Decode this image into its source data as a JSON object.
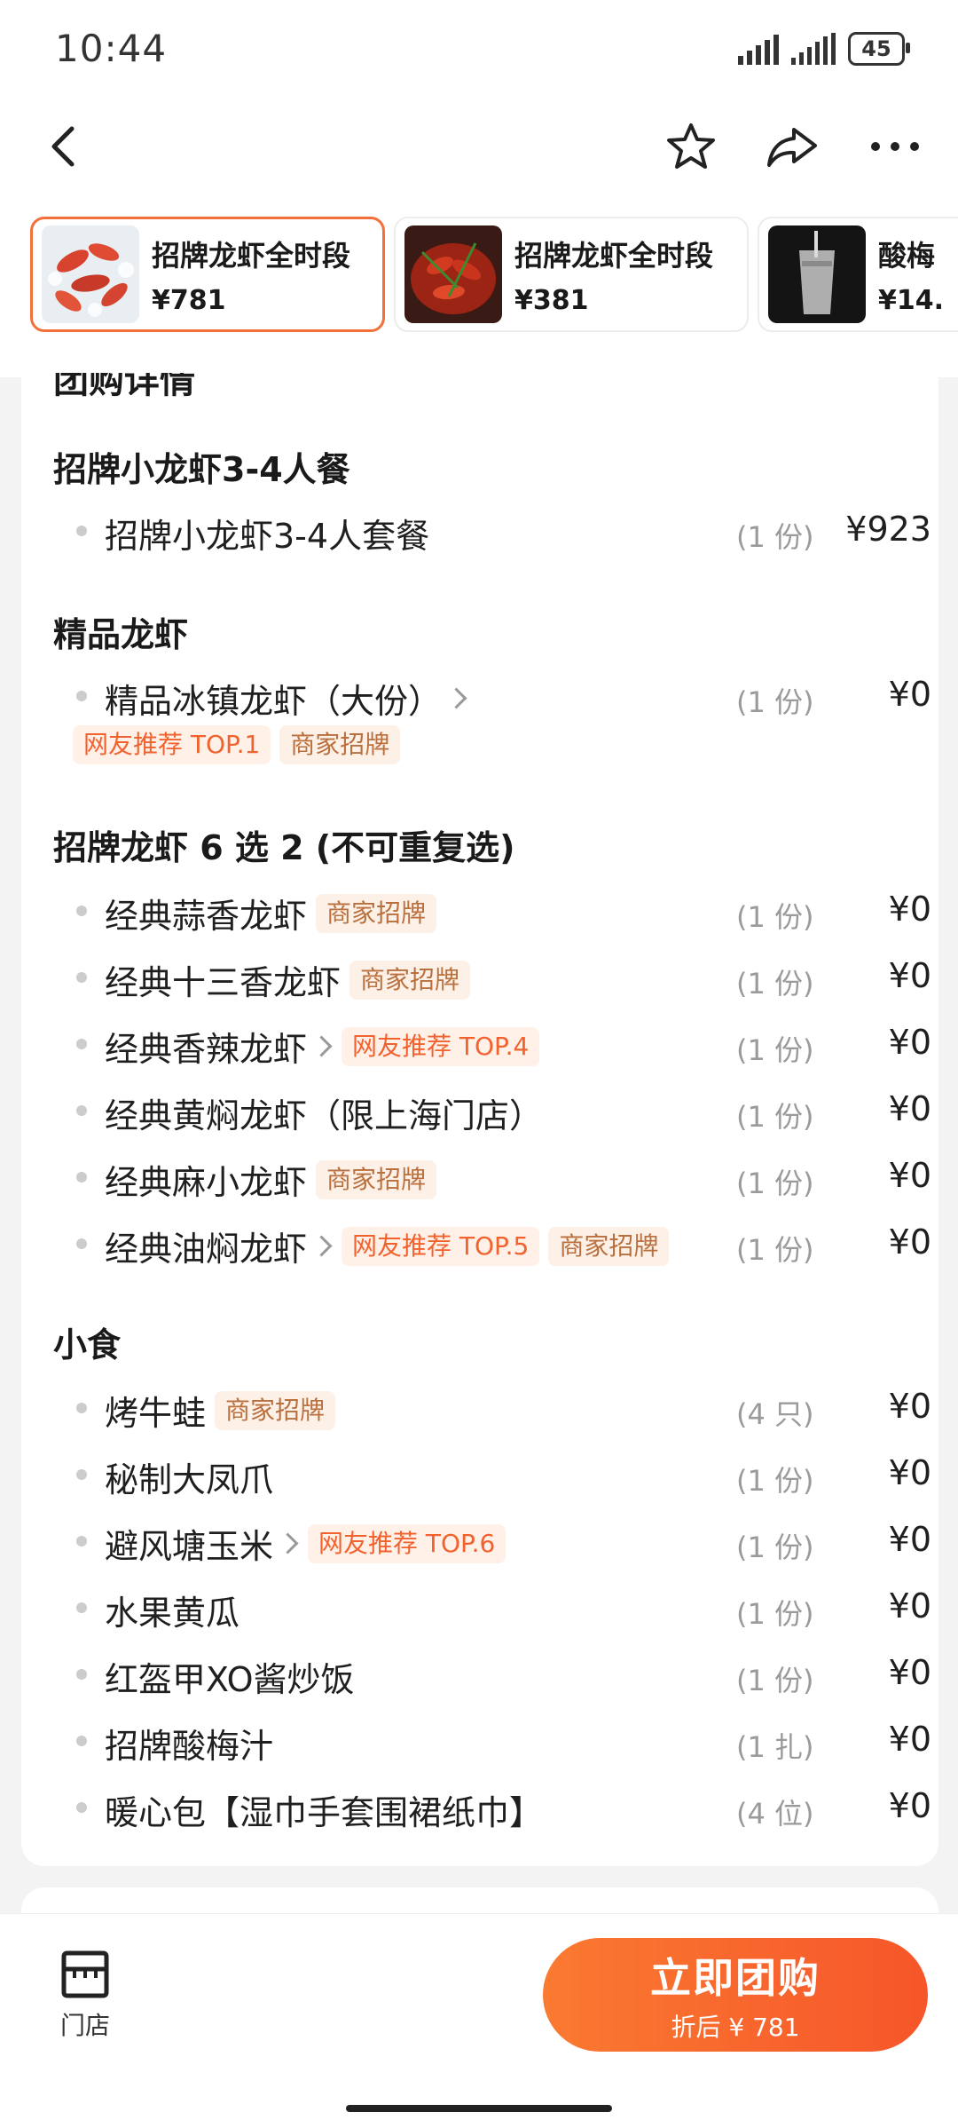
{
  "status_bar": {
    "time": "10:44",
    "battery": "45"
  },
  "nav": {
    "icons": [
      "back-icon",
      "star-icon",
      "share-icon",
      "more-icon"
    ]
  },
  "deal_tabs": [
    {
      "title": "招牌龙虾全时段",
      "price": "¥781",
      "active": true
    },
    {
      "title": "招牌龙虾全时段",
      "price": "¥381",
      "active": false
    },
    {
      "title": "酸梅",
      "price": "¥14.",
      "active": false
    }
  ],
  "detail": {
    "peek_title": "团购详情",
    "sections": [
      {
        "title": "招牌小龙虾3-4人餐",
        "items": [
          {
            "name": "招牌小龙虾3-4人套餐",
            "qty": "(1 份)",
            "price": "¥923"
          }
        ]
      },
      {
        "title": "精品龙虾",
        "items": [
          {
            "name": "精品冰镇龙虾（大份）",
            "qty": "(1 份)",
            "price": "¥0",
            "tags": [
              "网友推荐 TOP.1",
              "商家招牌"
            ]
          }
        ]
      },
      {
        "title": "招牌龙虾 6 选 2 (不可重复选)",
        "items": [
          {
            "name": "经典蒜香龙虾",
            "tag": "商家招牌",
            "qty": "(1 份)",
            "price": "¥0"
          },
          {
            "name": "经典十三香龙虾",
            "tag": "商家招牌",
            "qty": "(1 份)",
            "price": "¥0"
          },
          {
            "name": "经典香辣龙虾",
            "tag": "网友推荐 TOP.4",
            "qty": "(1 份)",
            "price": "¥0"
          },
          {
            "name": "经典黄焖龙虾（限上海门店）",
            "qty": "(1 份)",
            "price": "¥0"
          },
          {
            "name": "经典麻小龙虾",
            "tag": "商家招牌",
            "qty": "(1 份)",
            "price": "¥0"
          },
          {
            "name": "经典油焖龙虾",
            "tag": "网友推荐 TOP.5",
            "tag2": "商家招牌",
            "qty": "(1 份)",
            "price": "¥0"
          }
        ]
      },
      {
        "title": "小食",
        "items": [
          {
            "name": "烤牛蛙",
            "tag": "商家招牌",
            "qty": "(4 只)",
            "price": "¥0"
          },
          {
            "name": "秘制大凤爪",
            "qty": "(1 份)",
            "price": "¥0"
          },
          {
            "name": "避风塘玉米",
            "tag": "网友推荐 TOP.6",
            "qty": "(1 份)",
            "price": "¥0"
          },
          {
            "name": "水果黄瓜",
            "qty": "(1 份)",
            "price": "¥0"
          },
          {
            "name": "红盔甲XO酱炒饭",
            "qty": "(1 份)",
            "price": "¥0"
          },
          {
            "name": "招牌酸梅汁",
            "qty": "(1 扎)",
            "price": "¥0"
          },
          {
            "name": "暖心包【湿巾手套围裙纸巾】",
            "qty": "(4 位)",
            "price": "¥0"
          }
        ]
      }
    ]
  },
  "bottom_bar": {
    "store_label": "门店",
    "buy_label": "立即团购",
    "buy_sub": "折后 ¥ 781"
  },
  "colors": {
    "accent": "#f6622c",
    "tag_top_text": "#f2622e",
    "tag_merchant_text": "#b9703e"
  }
}
